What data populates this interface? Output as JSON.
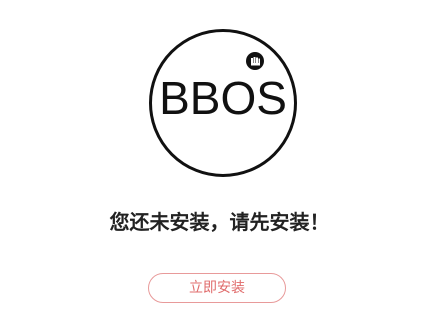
{
  "logo": {
    "text": "BBOS",
    "badge_icon": "fist-icon"
  },
  "message": "您还未安装，请先安装！",
  "install_button": {
    "label": "立即安装",
    "border_color": "#e89a9a",
    "text_color": "#e06c6c"
  }
}
